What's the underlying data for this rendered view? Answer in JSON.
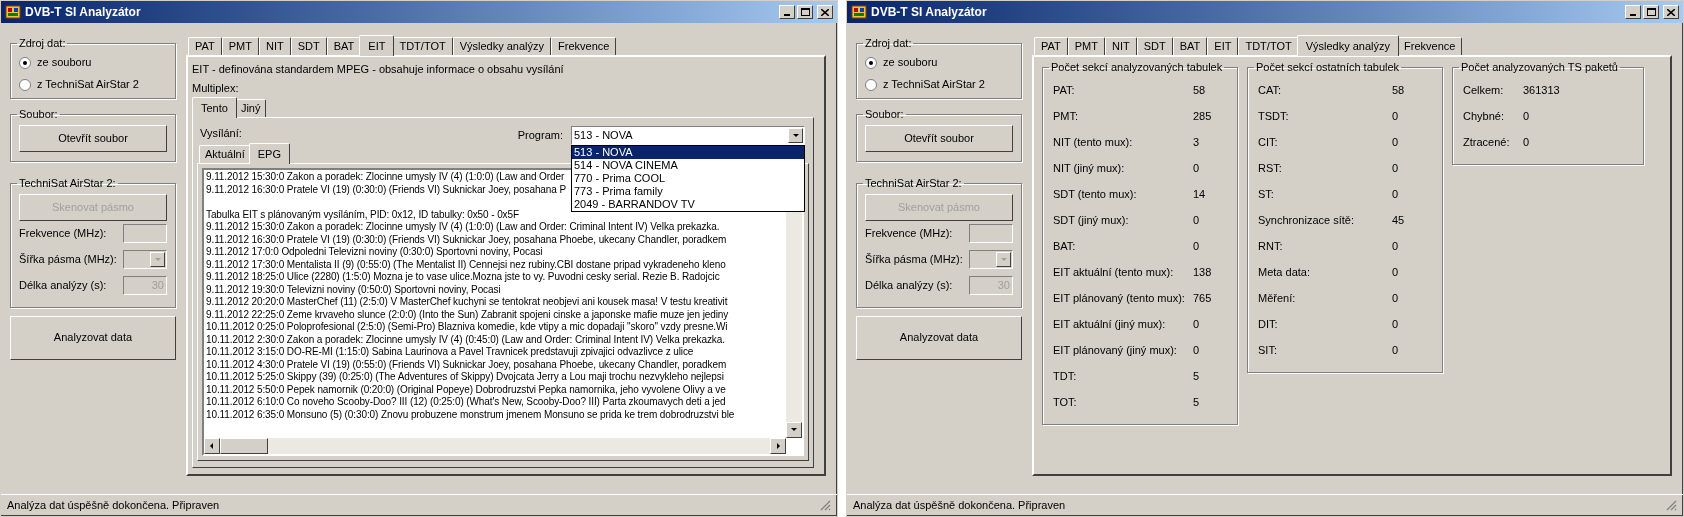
{
  "windows": [
    {
      "title": "DVB-T SI Analyzátor",
      "source": {
        "legend": "Zdroj dat:",
        "options": [
          {
            "label": "ze souboru",
            "selected": true
          },
          {
            "label": "z TechniSat AirStar 2",
            "selected": false
          }
        ]
      },
      "file": {
        "legend": "Soubor:",
        "button": "Otevřít soubor"
      },
      "tuner": {
        "legend": "TechniSat AirStar 2:",
        "disabled": true,
        "scan_button": "Skenovat pásmo",
        "frequency_label": "Frekvence (MHz):",
        "bandwidth_label": "Šířka pásma (MHz):",
        "duration_label": "Délka analýzy (s):",
        "duration_value": "30"
      },
      "analyze_button": "Analyzovat data",
      "tabs": [
        {
          "label": "PAT",
          "selected": false
        },
        {
          "label": "PMT",
          "selected": false
        },
        {
          "label": "NIT",
          "selected": false
        },
        {
          "label": "SDT",
          "selected": false
        },
        {
          "label": "BAT",
          "selected": false
        },
        {
          "label": "EIT",
          "selected": true
        },
        {
          "label": "TDT/TOT",
          "selected": false
        },
        {
          "label": "Výsledky analýzy",
          "selected": false
        },
        {
          "label": "Frekvence",
          "selected": false
        }
      ],
      "content": {
        "kind": "eit",
        "description": "EIT - definována standardem MPEG - obsahuje informace o obsahu vysílání",
        "multiplex_label": "Multiplex:",
        "multiplex_tabs": [
          {
            "label": "Tento",
            "selected": true
          },
          {
            "label": "Jiný",
            "selected": false
          }
        ],
        "broadcast_label": "Vysílání:",
        "program_label": "Program:",
        "program_value": "513 -  NOVA",
        "program_options": [
          {
            "label": "513 -  NOVA",
            "selected": true
          },
          {
            "label": "514 - NOVA CINEMA",
            "selected": false
          },
          {
            "label": "770 - Prima COOL",
            "selected": false
          },
          {
            "label": "773 - Prima family",
            "selected": false
          },
          {
            "label": "2049 - BARRANDOV TV",
            "selected": false
          }
        ],
        "view_tabs": [
          {
            "label": "Aktuální",
            "selected": false
          },
          {
            "label": "EPG",
            "selected": true
          }
        ],
        "current_lines": [
          "9.11.2012 15:30:0 Zakon a poradek: Zlocinne umysly IV (4) (1:0:0) (Law and Order",
          "9.11.2012 16:30:0 Pratele VI (19) (0:30:0) (Friends VI) Suknickar Joey, posahana P"
        ],
        "schedule_heading": "Tabulka EIT s plánovaným vysíláním, PID: 0x12, ID tabulky: 0x50 - 0x5F",
        "schedule_lines": [
          "9.11.2012 15:30:0 Zakon a poradek: Zlocinne umysly IV (4) (1:0:0) (Law and Order: Criminal Intent IV)  Velka prekazka.",
          "9.11.2012 16:30:0 Pratele VI (19) (0:30:0) (Friends VI) Suknickar Joey, posahana Phoebe, ukecany Chandler, poradkem",
          "9.11.2012 17:0:0 Odpoledni Televizni noviny (0:30:0) Sportovni noviny, Pocasi",
          "9.11.2012 17:30:0 Mentalista II (9) (0:55:0) (The Mentalist II)  Cennejsi nez rubiny.CBI dostane pripad vykradeneho kleno",
          "9.11.2012 18:25:0 Ulice (2280) (1:5:0) Mozna je to vase ulice.Mozna jste to vy. Puvodni cesky serial. Rezie B. Radojcic",
          "9.11.2012 19:30:0 Televizni noviny (0:50:0) Sportovni noviny, Pocasi",
          "9.11.2012 20:20:0 MasterChef (11) (2:5:0) V MasterChef kuchyni se tentokrat neobjevi ani kousek masa! V testu kreativit",
          "9.11.2012 22:25:0 Zeme krvaveho slunce (2:0:0) (Into the Sun) Zabranit spojeni cinske a japonske mafie muze jen jediny",
          "10.11.2012 0:25:0 Poloprofesional (2:5:0) (Semi-Pro) Blazniva komedie, kde vtipy a mic dopadaji \"skoro\" vzdy presne.Wi",
          "10.11.2012 2:30:0 Zakon a poradek: Zlocinne umysly IV (4) (0:45:0) (Law and Order: Criminal Intent IV)  Velka prekazka.",
          "10.11.2012 3:15:0 DO-RE-MI (1:15:0) Sabina Laurinova a Pavel Travnicek predstavuji zpivajici odvazlivce z ulice",
          "10.11.2012 4:30:0 Pratele VI (19) (0:55:0) (Friends VI) Suknickar Joey, posahana Phoebe, ukecany Chandler, poradkem",
          "10.11.2012 5:25:0 Skippy (39) (0:25:0) (The Adventures of Skippy) Dvojcata Jerry a Lou maji trochu nezvykleho nejlepsi",
          "10.11.2012 5:50:0 Pepek namornik (0:20:0) (Original Popeye) Dobrodruzstvi Pepka namornika, jeho vyvolene Olivy a ve",
          "10.11.2012 6:10:0 Co noveho Scooby-Doo? III (12) (0:25:0) (What's New, Scooby-Doo? III) Parta zkoumavych deti a jed",
          "10.11.2012 6:35:0 Monsuno (5) (0:30:0) Znovu probuzene monstrum jmenem Monsuno se prida ke trem dobrodruzstvi ble"
        ]
      },
      "status_bar": "Analýza dat úspěšně dokončena. Připraven"
    },
    {
      "title": "DVB-T SI Analyzátor",
      "source": {
        "legend": "Zdroj dat:",
        "options": [
          {
            "label": "ze souboru",
            "selected": true
          },
          {
            "label": "z TechniSat AirStar 2",
            "selected": false
          }
        ]
      },
      "file": {
        "legend": "Soubor:",
        "button": "Otevřít soubor"
      },
      "tuner": {
        "legend": "TechniSat AirStar 2:",
        "disabled": true,
        "scan_button": "Skenovat pásmo",
        "frequency_label": "Frekvence (MHz):",
        "bandwidth_label": "Šířka pásma (MHz):",
        "duration_label": "Délka analýzy (s):",
        "duration_value": "30"
      },
      "analyze_button": "Analyzovat data",
      "tabs": [
        {
          "label": "PAT",
          "selected": false
        },
        {
          "label": "PMT",
          "selected": false
        },
        {
          "label": "NIT",
          "selected": false
        },
        {
          "label": "SDT",
          "selected": false
        },
        {
          "label": "BAT",
          "selected": false
        },
        {
          "label": "EIT",
          "selected": false
        },
        {
          "label": "TDT/TOT",
          "selected": false
        },
        {
          "label": "Výsledky analýzy",
          "selected": true
        },
        {
          "label": "Frekvence",
          "selected": false
        }
      ],
      "content": {
        "kind": "results",
        "groups": [
          {
            "legend": "Počet sekcí analyzovaných tabulek",
            "rows": [
              {
                "label": "PAT:",
                "value": "58"
              },
              {
                "label": "PMT:",
                "value": "285"
              },
              {
                "label": "NIT (tento mux):",
                "value": "3"
              },
              {
                "label": "NIT (jiný mux):",
                "value": "0"
              },
              {
                "label": "SDT (tento mux):",
                "value": "14"
              },
              {
                "label": "SDT (jiný mux):",
                "value": "0"
              },
              {
                "label": "BAT:",
                "value": "0"
              },
              {
                "label": "EIT aktuální (tento mux):",
                "value": "138"
              },
              {
                "label": "EIT plánovaný (tento mux):",
                "value": "765"
              },
              {
                "label": "EIT aktuální (jiný mux):",
                "value": "0"
              },
              {
                "label": "EIT plánovaný (jiný mux):",
                "value": "0"
              },
              {
                "label": "TDT:",
                "value": "5"
              },
              {
                "label": "TOT:",
                "value": "5"
              }
            ]
          },
          {
            "legend": "Počet sekcí ostatních tabulek",
            "rows": [
              {
                "label": "CAT:",
                "value": "58"
              },
              {
                "label": "TSDT:",
                "value": "0"
              },
              {
                "label": "CIT:",
                "value": "0"
              },
              {
                "label": "RST:",
                "value": "0"
              },
              {
                "label": "ST:",
                "value": "0"
              },
              {
                "label": "Synchronizace sítě:",
                "value": "45"
              },
              {
                "label": "RNT:",
                "value": "0"
              },
              {
                "label": "Meta data:",
                "value": "0"
              },
              {
                "label": "Měření:",
                "value": "0"
              },
              {
                "label": "DIT:",
                "value": "0"
              },
              {
                "label": "SIT:",
                "value": "0"
              }
            ]
          },
          {
            "legend": "Počet analyzovaných TS paketů",
            "rows": [
              {
                "label": "Celkem:",
                "value": "361313"
              },
              {
                "label": "Chybné:",
                "value": "0"
              },
              {
                "label": "Ztracené:",
                "value": "0"
              }
            ]
          }
        ]
      },
      "status_bar": "Analýza dat úspěšně dokončena. Připraven"
    }
  ]
}
